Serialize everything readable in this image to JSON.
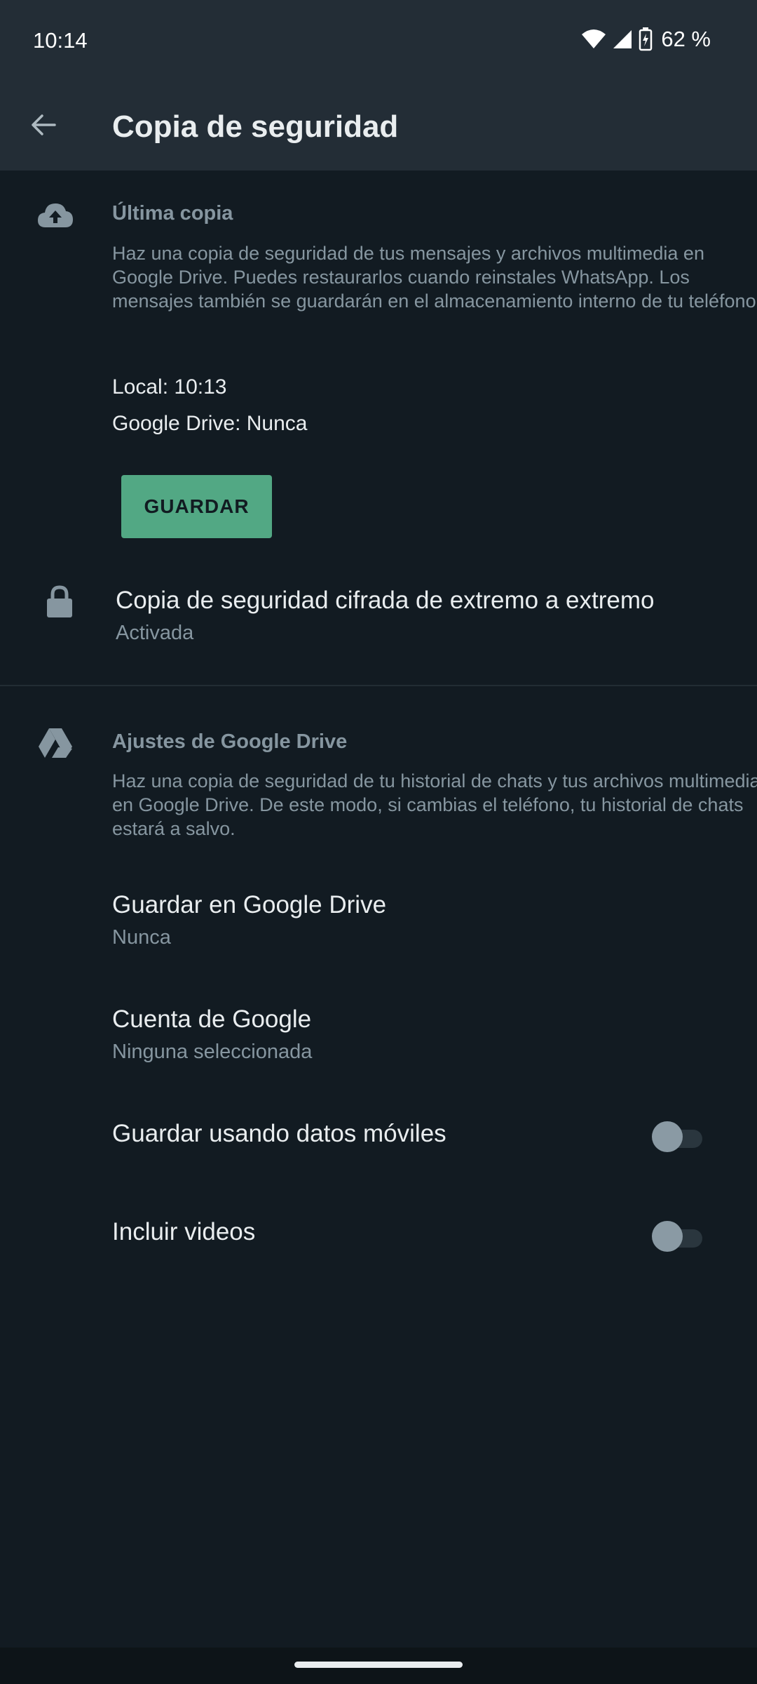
{
  "status_bar": {
    "time": "10:14",
    "battery": "62 %",
    "icons": [
      "wifi-icon",
      "signal-icon",
      "battery-icon"
    ]
  },
  "app_bar": {
    "title": "Copia de seguridad",
    "back_icon": "arrow-left-icon"
  },
  "last_backup": {
    "icon": "cloud-upload-icon",
    "heading": "Última copia",
    "description": "Haz una copia de seguridad de tus mensajes y archivos multimedia en Google Drive. Puedes restaurarlos cuando reinstales WhatsApp. Los mensajes también se guardarán en el almacenamiento interno de tu teléfono.",
    "local": "Local: 10:13",
    "drive": "Google Drive: Nunca",
    "save_button": "GUARDAR"
  },
  "encrypted": {
    "icon": "lock-icon",
    "title": "Copia de seguridad cifrada de extremo a extremo",
    "status": "Activada"
  },
  "drive_settings": {
    "icon": "google-drive-icon",
    "heading": "Ajustes de Google Drive",
    "description": "Haz una copia de seguridad de tu historial de chats y tus archivos multimedia en Google Drive. De este modo, si cambias el teléfono, tu historial de chats estará a salvo.",
    "items": [
      {
        "title": "Guardar en Google Drive",
        "subtitle": "Nunca"
      },
      {
        "title": "Cuenta de Google",
        "subtitle": "Ninguna seleccionada"
      }
    ],
    "toggles": [
      {
        "label": "Guardar usando datos móviles",
        "on": false
      },
      {
        "label": "Incluir videos",
        "on": false
      }
    ]
  },
  "colors": {
    "background": "#121b22",
    "app_bar": "#232d36",
    "accent": "#52a884",
    "secondary_text": "#8696a0"
  }
}
